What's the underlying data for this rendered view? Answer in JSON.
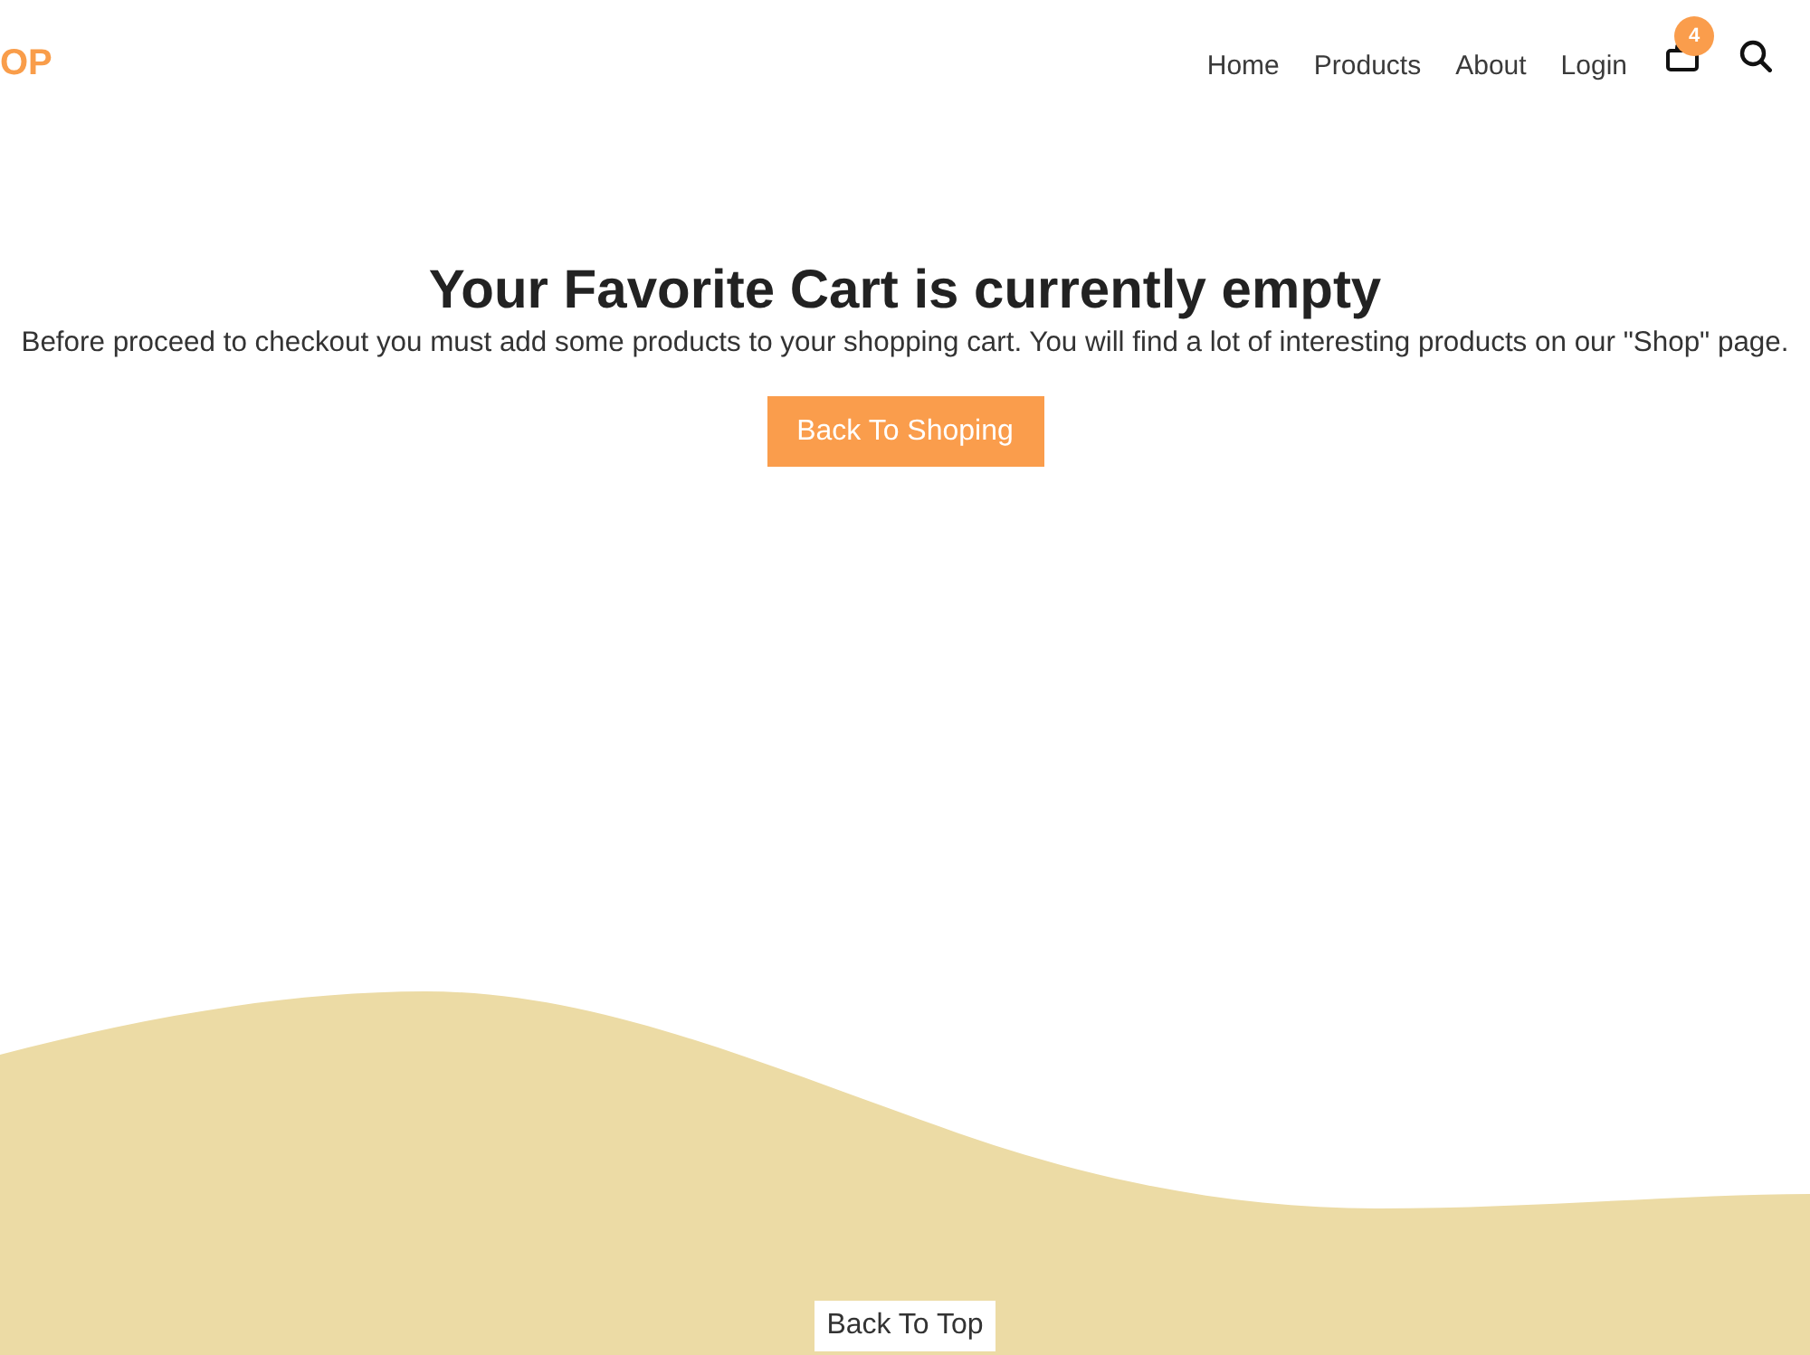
{
  "header": {
    "logo": "OP",
    "nav": [
      "Home",
      "Products",
      "About",
      "Login"
    ],
    "cart": {
      "count": "4"
    }
  },
  "empty_cart": {
    "title": "Your Favorite Cart is currently empty",
    "message": "Before proceed to checkout you must add some products to your shopping cart. You will find a lot of interesting products on our \"Shop\" page.",
    "button": "Back To Shoping"
  },
  "footer": {
    "back_to_top": "Back To Top"
  }
}
